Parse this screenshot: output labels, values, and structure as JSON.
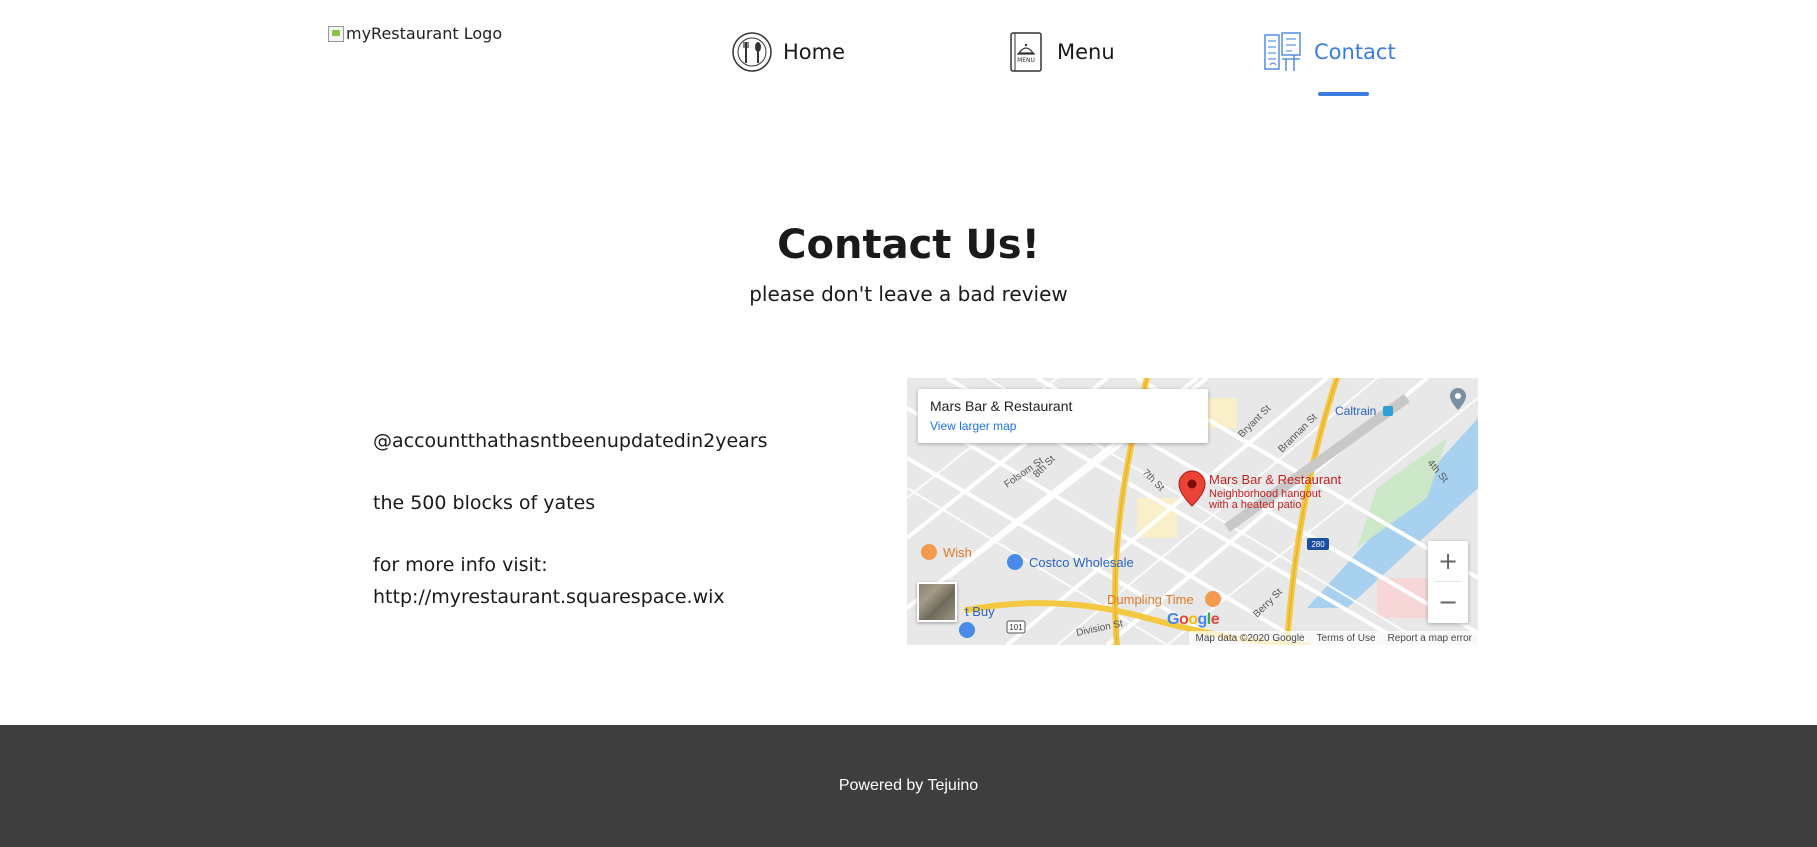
{
  "header": {
    "logo_alt": "myRestaurant Logo",
    "nav": [
      {
        "label": "Home",
        "icon": "plate-cutlery-icon",
        "active": false
      },
      {
        "label": "Menu",
        "icon": "menu-book-icon",
        "active": false
      },
      {
        "label": "Contact",
        "icon": "city-map-icon",
        "active": true
      }
    ],
    "accent_color": "#3b7ddd"
  },
  "main": {
    "title": "Contact Us!",
    "subtitle": "please don't leave a bad review",
    "contact": {
      "handle": "@accountthathasntbeenupdatedin2years",
      "address": "the 500 blocks of yates",
      "more_info_label": "for more info visit:",
      "url": "http://myrestaurant.squarespace.wix"
    }
  },
  "map": {
    "card_title": "Mars Bar & Restaurant",
    "card_link": "View larger map",
    "pin_title": "Mars Bar & Restaurant",
    "pin_desc_line1": "Neighborhood hangout",
    "pin_desc_line2": "with a heated patio",
    "labels": {
      "wish": "Wish",
      "costco": "Costco Wholesale",
      "dumpling": "Dumpling Time",
      "caltrain": "Caltrain",
      "buy": "t Buy",
      "folsom": "Folsom St",
      "eighth": "8th St",
      "seventh": "7th St",
      "division": "Division St",
      "bryant": "Bryant St",
      "brannan": "Brannan St",
      "fourth": "4th St",
      "berry": "Berry St",
      "hwy101": "101",
      "hwy280": "280"
    },
    "zoom_in": "+",
    "zoom_out": "−",
    "google": "Google",
    "map_data": "Map data ©2020 Google",
    "terms": "Terms of Use",
    "report": "Report a map error"
  },
  "footer": {
    "text": "Powered by Tejuino",
    "background": "#3e3e3e"
  }
}
